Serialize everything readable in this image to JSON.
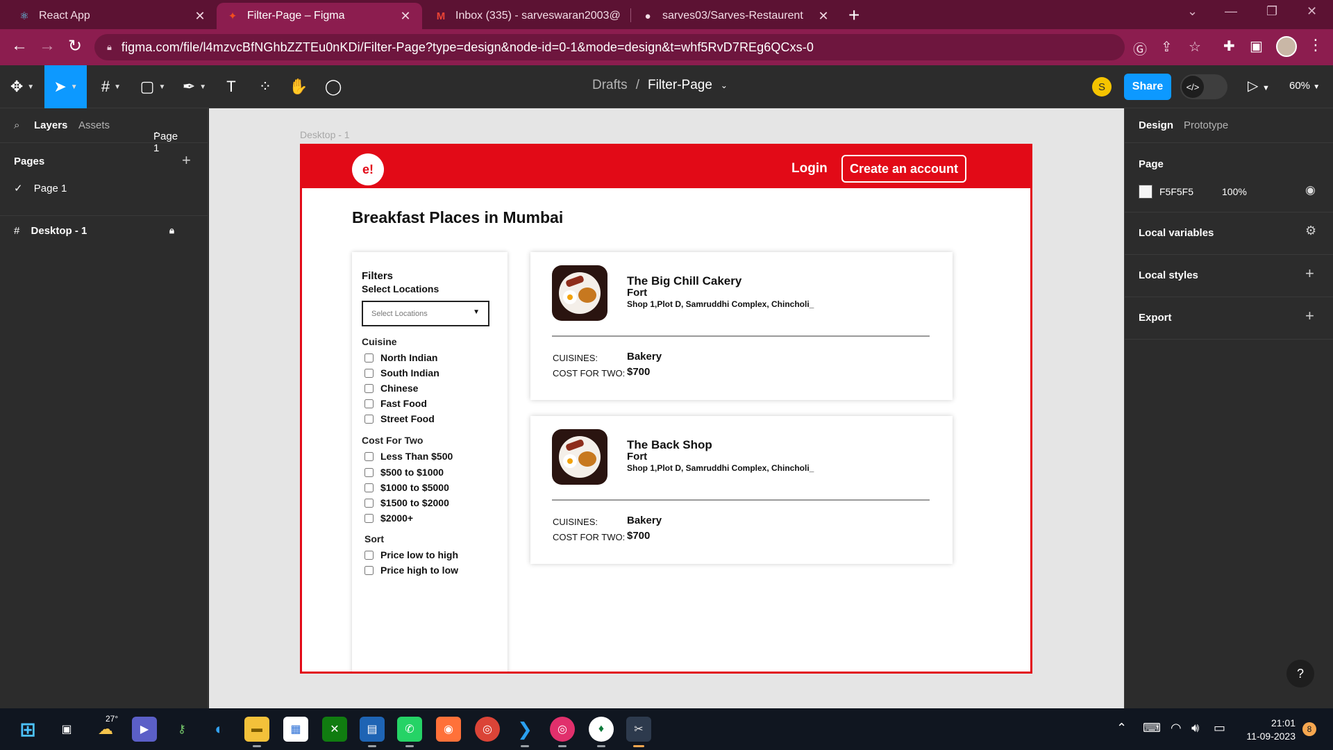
{
  "browser": {
    "tabs": [
      {
        "title": "React App",
        "active": false
      },
      {
        "title": "Filter-Page – Figma",
        "active": true
      },
      {
        "title": "Inbox (335) - sarveswaran2003@",
        "active": false
      },
      {
        "title": "sarves03/Sarves-Restaurent",
        "active": false
      }
    ],
    "url": "figma.com/file/l4mzvcBfNGhbZZTEu0nKDi/Filter-Page?type=design&node-id=0-1&mode=design&t=whf5RvD7REg6QCxs-0"
  },
  "figma": {
    "breadcrumb": {
      "folder": "Drafts",
      "separator": "/",
      "file": "Filter-Page"
    },
    "avatar_initial": "S",
    "share_label": "Share",
    "dev_mode_glyph": "</>",
    "zoom": "60%",
    "left_panel": {
      "tab_layers": "Layers",
      "tab_assets": "Assets",
      "page_selector": "Page 1",
      "pages_heading": "Pages",
      "page_item": "Page 1",
      "layer_item": "Desktop - 1"
    },
    "right_panel": {
      "tab_design": "Design",
      "tab_prototype": "Prototype",
      "page_label": "Page",
      "page_color": "F5F5F5",
      "page_opacity": "100%",
      "local_variables": "Local variables",
      "local_styles": "Local styles",
      "export": "Export",
      "help": "?"
    }
  },
  "canvas": {
    "frame_label": "Desktop - 1",
    "site": {
      "logo": "e!",
      "login": "Login",
      "create_account": "Create an account",
      "heading": "Breakfast Places in Mumbai",
      "filters": {
        "title": "Filters",
        "select_locations_label": "Select Locations",
        "select_locations_placeholder": "Select Locations",
        "cuisine_heading": "Cuisine",
        "cuisines": [
          "North Indian",
          "South Indian",
          "Chinese",
          "Fast Food",
          "Street Food"
        ],
        "cost_heading": "Cost For Two",
        "costs": [
          "Less Than $500",
          "$500 to $1000",
          "$1000 to $5000",
          "$1500 to $2000",
          "$2000+"
        ],
        "sort_heading": "Sort",
        "sorts": [
          "Price low to high",
          "Price high to low"
        ]
      },
      "restaurants": [
        {
          "name": "The Big Chill Cakery",
          "location": "Fort",
          "address": "Shop 1,Plot D, Samruddhi Complex, Chincholi_",
          "cuisines_label": "CUISINES:",
          "cuisines_value": "Bakery",
          "cost_label": "COST FOR TWO:",
          "cost_value": "$700"
        },
        {
          "name": "The Back Shop",
          "location": "Fort",
          "address": "Shop 1,Plot D, Samruddhi Complex, Chincholi_",
          "cuisines_label": "CUISINES:",
          "cuisines_value": "Bakery",
          "cost_label": "COST FOR TWO:",
          "cost_value": "$700"
        }
      ]
    }
  },
  "taskbar": {
    "weather_temp": "27°",
    "time": "21:01",
    "date": "11-09-2023",
    "notifications": "8"
  },
  "colors": {
    "browser_tabbar": "#5c1233",
    "browser_toolbar": "#8c1d4f",
    "figma_accent": "#0d99ff",
    "site_red": "#e20a17",
    "page_bg": "#F5F5F5"
  }
}
